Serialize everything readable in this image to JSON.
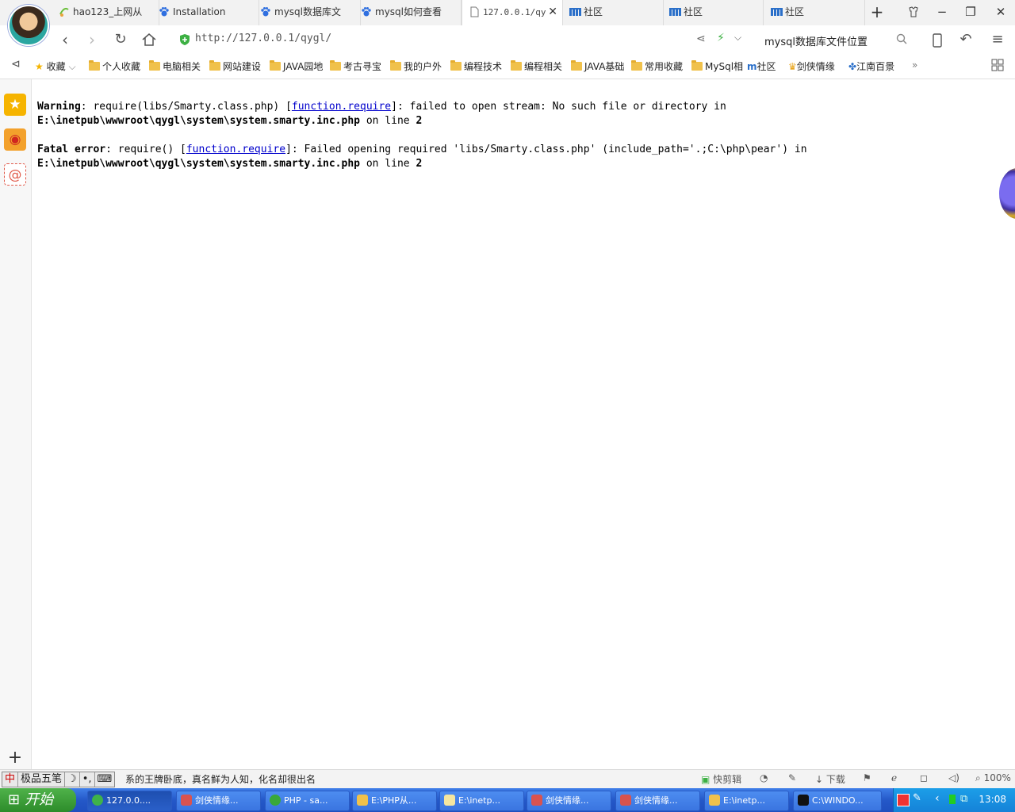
{
  "tabs": [
    {
      "label": "hao123_上网从",
      "icon": "hao123-icon",
      "active": false
    },
    {
      "label": "Installation",
      "icon": "paw-icon",
      "active": false
    },
    {
      "label": "mysql数据库文",
      "icon": "paw-icon",
      "active": false
    },
    {
      "label": "mysql如何查看",
      "icon": "paw-icon",
      "active": false
    },
    {
      "label": "127.0.0.1/qy",
      "icon": "page-icon",
      "active": true
    },
    {
      "label": "社区",
      "icon": "community-icon",
      "active": false
    },
    {
      "label": "社区",
      "icon": "community-icon",
      "active": false
    },
    {
      "label": "社区",
      "icon": "community-icon",
      "active": false
    }
  ],
  "nav": {
    "url": "http://127.0.0.1/qygl/",
    "search": "mysql数据库文件位置"
  },
  "bookmarks": {
    "favorites": "收藏",
    "items": [
      {
        "label": "个人收藏",
        "icon": "folder"
      },
      {
        "label": "电脑相关",
        "icon": "folder"
      },
      {
        "label": "网站建设",
        "icon": "folder"
      },
      {
        "label": "JAVA园地",
        "icon": "folder"
      },
      {
        "label": "考古寻宝",
        "icon": "folder"
      },
      {
        "label": "我的户外",
        "icon": "folder"
      },
      {
        "label": "编程技术",
        "icon": "folder"
      },
      {
        "label": "编程相关",
        "icon": "folder"
      },
      {
        "label": "JAVA基础",
        "icon": "folder"
      },
      {
        "label": "常用收藏",
        "icon": "folder"
      },
      {
        "label": "MySql相",
        "icon": "folder"
      },
      {
        "label": "社区",
        "icon": "community"
      },
      {
        "label": "剑侠情缘",
        "icon": "trophy"
      },
      {
        "label": "江南百景",
        "icon": "pinwheel"
      }
    ],
    "more": "»"
  },
  "page": {
    "warning": {
      "label": "Warning",
      "text1": ": require(libs/Smarty.class.php) [",
      "link": "function.require",
      "text2": "]: failed to open stream: No such file or directory in",
      "file": "E:\\inetpub\\wwwroot\\qygl\\system\\system.smarty.inc.php",
      "on_line": " on line ",
      "line": "2"
    },
    "fatal": {
      "label": "Fatal error",
      "text1": ": require() [",
      "link": "function.require",
      "text2": "]: Failed opening required 'libs/Smarty.class.php' (include_path='.;C:\\php\\pear') in",
      "file": "E:\\inetpub\\wwwroot\\qygl\\system\\system.smarty.inc.php",
      "on_line": " on line ",
      "line": "2"
    }
  },
  "statusbar": {
    "ime": [
      "中",
      "极品五笔",
      "☽",
      "•,",
      "⌨"
    ],
    "ticker": "系的王牌卧底，真名鲜为人知，化名却很出名",
    "quick_edit": "快剪辑",
    "download": "下载",
    "zoom": "100%"
  },
  "taskbar": {
    "start": "开始",
    "tasks": [
      {
        "label": "127.0.0....",
        "active": true,
        "color": "#3fb24a"
      },
      {
        "label": "剑侠情缘...",
        "active": false,
        "color": "#d9534f"
      },
      {
        "label": "PHP - sa...",
        "active": false,
        "color": "#39a83a"
      },
      {
        "label": "E:\\PHP从...",
        "active": false,
        "color": "#f0c14b"
      },
      {
        "label": "E:\\inetp...",
        "active": false,
        "color": "#f5e6a0"
      },
      {
        "label": "剑侠情缘...",
        "active": false,
        "color": "#d9534f"
      },
      {
        "label": "剑侠情缘...",
        "active": false,
        "color": "#d9534f"
      },
      {
        "label": "E:\\inetp...",
        "active": false,
        "color": "#f0c14b"
      },
      {
        "label": "C:\\WINDO...",
        "active": false,
        "color": "#111111"
      }
    ],
    "clock": "13:08"
  },
  "colors": {
    "link": "#0000cc",
    "taskbar": "#2458c8",
    "start": "#2d8c2a",
    "secure": "#3cb043"
  }
}
